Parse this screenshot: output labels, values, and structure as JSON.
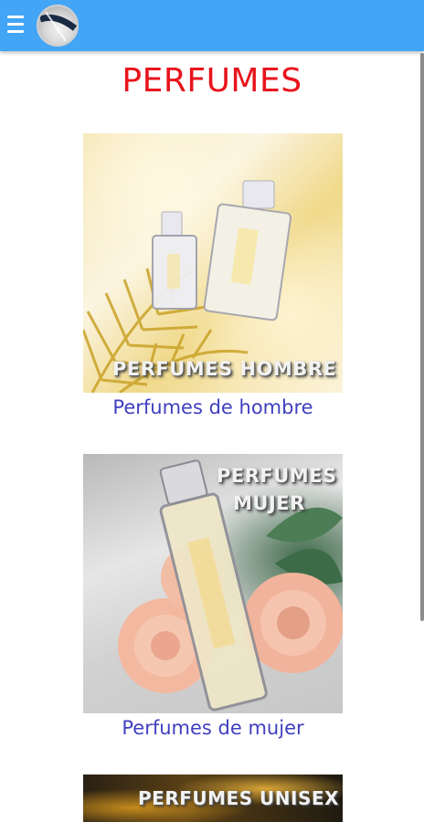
{
  "header": {
    "menu_icon": "hamburger-menu-icon",
    "logo_icon": "brand-logo-icon",
    "accent_color": "#42a5f5"
  },
  "page": {
    "title": "PERFUMES",
    "title_color": "#e8141c"
  },
  "categories": [
    {
      "image_text": "PERFUMES HOMBRE",
      "label": "Perfumes de hombre"
    },
    {
      "image_text_line1": "PERFUMES",
      "image_text_line2": "MUJER",
      "label": "Perfumes de mujer"
    },
    {
      "image_text": "PERFUMES UNISEX"
    }
  ],
  "link_color": "#3f3fbf"
}
